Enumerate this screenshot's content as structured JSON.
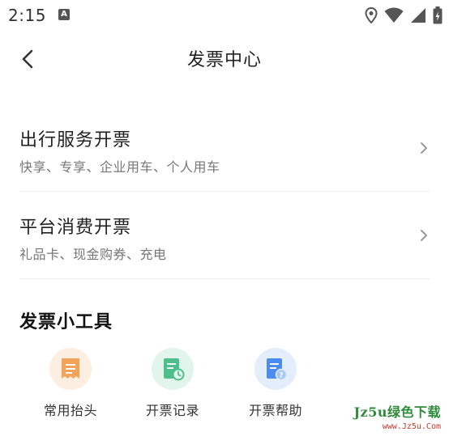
{
  "status_bar": {
    "time": "2:15",
    "notification_letter": "A",
    "icons": [
      "location-icon",
      "wifi-icon",
      "signal-icon",
      "battery-charging-icon"
    ]
  },
  "nav": {
    "back_icon": "chevron-left-icon",
    "title": "发票中心"
  },
  "menu": [
    {
      "title": "出行服务开票",
      "subtitle": "快享、专享、企业用车、个人用车"
    },
    {
      "title": "平台消费开票",
      "subtitle": "礼品卡、现金购券、充电"
    }
  ],
  "tools_section": {
    "title": "发票小工具",
    "items": [
      {
        "label": "常用抬头",
        "icon": "receipt-icon",
        "color": "#f5a35a",
        "bg": "#fdeee2"
      },
      {
        "label": "开票记录",
        "icon": "document-clock-icon",
        "color": "#4cbf8c",
        "bg": "#e2f5ec"
      },
      {
        "label": "开票帮助",
        "icon": "document-help-icon",
        "color": "#4a8cf0",
        "bg": "#e3edfc"
      }
    ]
  },
  "watermark": {
    "main": "Jz5u绿色下载",
    "url": "www.Jz5u.Com"
  }
}
